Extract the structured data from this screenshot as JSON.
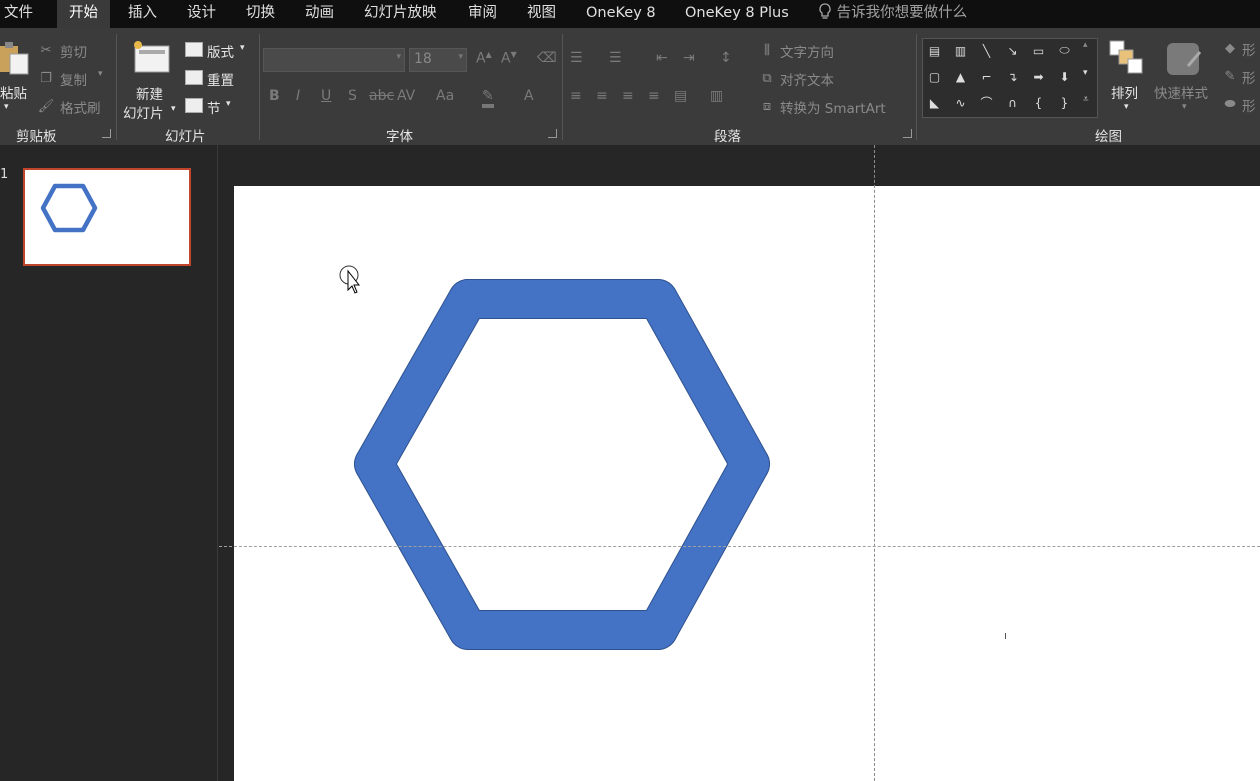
{
  "tabs": [
    {
      "label": "文件",
      "active": false
    },
    {
      "label": "开始",
      "active": true
    },
    {
      "label": "插入",
      "active": false
    },
    {
      "label": "设计",
      "active": false
    },
    {
      "label": "切换",
      "active": false
    },
    {
      "label": "动画",
      "active": false
    },
    {
      "label": "幻灯片放映",
      "active": false
    },
    {
      "label": "审阅",
      "active": false
    },
    {
      "label": "视图",
      "active": false
    },
    {
      "label": "OneKey 8",
      "active": false
    },
    {
      "label": "OneKey 8 Plus",
      "active": false
    }
  ],
  "tell_me": {
    "text": "告诉我你想要做什么",
    "icon": "lightbulb-icon"
  },
  "clipboard": {
    "paste_label": "粘贴",
    "cut_label": "剪切",
    "copy_label": "复制",
    "format_painter_label": "格式刷",
    "group_label": "剪贴板"
  },
  "slides_group": {
    "new_slide_line1": "新建",
    "new_slide_line2": "幻灯片",
    "layout_label": "版式",
    "reset_label": "重置",
    "section_label": "节",
    "group_label": "幻灯片"
  },
  "font_group": {
    "font_name": "",
    "font_size": "18",
    "group_label": "字体"
  },
  "paragraph_group": {
    "text_direction_label": "文字方向",
    "align_text_label": "对齐文本",
    "smartart_label": "转换为 SmartArt",
    "group_label": "段落"
  },
  "drawing_group": {
    "arrange_label": "排列",
    "quick_styles_label": "快速样式",
    "shape_fill_label": "形",
    "shape_outline_label": "形",
    "shape_effects_label": "形",
    "group_label": "绘图"
  },
  "slide_panel": {
    "slide_number": "1"
  },
  "colors": {
    "hexagon_fill": "#4472c4",
    "hexagon_stroke": "#2f528f",
    "thumb_border": "#c1452b",
    "ribbon_bg": "#3b3b3b",
    "tabbar_bg": "#0f0f0f"
  }
}
